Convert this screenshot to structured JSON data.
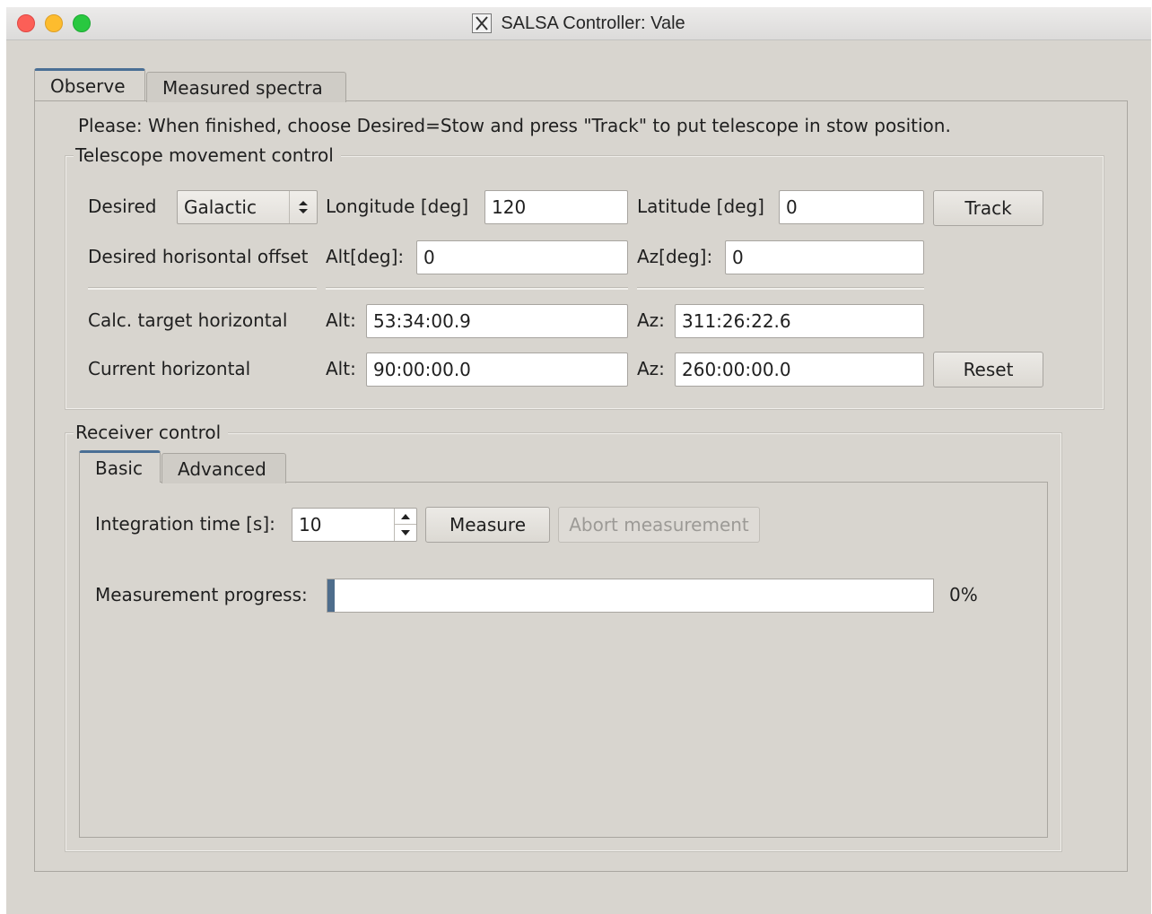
{
  "window": {
    "title": "SALSA Controller: Vale",
    "title_icon": "x11-icon"
  },
  "tabs": [
    {
      "label": "Observe",
      "active": true
    },
    {
      "label": "Measured spectra",
      "active": false
    }
  ],
  "observe": {
    "notice": "Please: When finished, choose Desired=Stow and press \"Track\" to put telescope in stow position.",
    "movement": {
      "title": "Telescope movement control",
      "desired_label": "Desired",
      "desired_value": "Galactic",
      "longitude_label": "Longitude [deg]",
      "longitude_value": "120",
      "latitude_label": "Latitude [deg]",
      "latitude_value": "0",
      "track_label": "Track",
      "offset_label": "Desired horisontal offset",
      "offset_alt_label": "Alt[deg]:",
      "offset_alt_value": "0",
      "offset_az_label": "Az[deg]:",
      "offset_az_value": "0",
      "calc_label": "Calc. target horizontal",
      "calc_alt_label": "Alt:",
      "calc_alt_value": "53:34:00.9",
      "calc_az_label": "Az:",
      "calc_az_value": "311:26:22.6",
      "current_label": "Current horizontal",
      "current_alt_label": "Alt:",
      "current_alt_value": "90:00:00.0",
      "current_az_label": "Az:",
      "current_az_value": "260:00:00.0",
      "reset_label": "Reset"
    },
    "receiver": {
      "title": "Receiver control",
      "tabs": [
        {
          "label": "Basic",
          "active": true
        },
        {
          "label": "Advanced",
          "active": false
        }
      ],
      "integration_label": "Integration time [s]:",
      "integration_value": "10",
      "measure_label": "Measure",
      "abort_label": "Abort measurement",
      "progress_label": "Measurement progress:",
      "progress_value": 0,
      "progress_text": "0%"
    }
  },
  "colors": {
    "window_bg": "#d8d5cf",
    "tab_accent": "#4a6f95",
    "progress_fill": "#4e6d8c"
  }
}
